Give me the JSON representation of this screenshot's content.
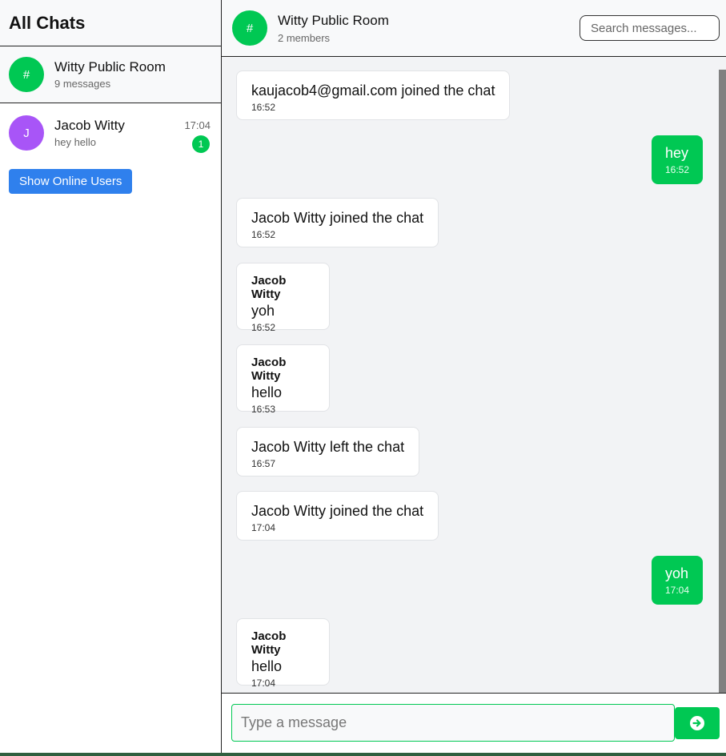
{
  "sidebar": {
    "title": "All Chats",
    "chats": [
      {
        "name": "Witty Public Room",
        "sub": "9 messages",
        "avatar": "#",
        "avatar_color": "#00c853"
      },
      {
        "name": "Jacob Witty",
        "sub": "hey hello",
        "avatar": "J",
        "avatar_color": "#a855f7",
        "time": "17:04",
        "unread": "1"
      }
    ],
    "online_button": "Show Online Users"
  },
  "header": {
    "avatar": "#",
    "title": "Witty Public Room",
    "members": "2 members",
    "search_placeholder": "Search messages..."
  },
  "messages": [
    {
      "dir": "in",
      "text": "kaujacob4@gmail.com joined the chat",
      "time": "16:52"
    },
    {
      "dir": "out",
      "text": "hey",
      "time": "16:52"
    },
    {
      "dir": "in",
      "text": "Jacob Witty joined the chat",
      "time": "16:52"
    },
    {
      "dir": "in",
      "sender": "Jacob Witty",
      "text": "yoh",
      "time": "16:52"
    },
    {
      "dir": "in",
      "sender": "Jacob Witty",
      "text": "hello",
      "time": "16:53"
    },
    {
      "dir": "in",
      "text": "Jacob Witty left the chat",
      "time": "16:57"
    },
    {
      "dir": "in",
      "text": "Jacob Witty joined the chat",
      "time": "17:04"
    },
    {
      "dir": "out",
      "text": "yoh",
      "time": "17:04"
    },
    {
      "dir": "in",
      "sender": "Jacob Witty",
      "text": "hello",
      "time": "17:04"
    }
  ],
  "composer": {
    "placeholder": "Type a message"
  },
  "colors": {
    "accent": "#00c853",
    "button_blue": "#2f80ed",
    "dm_avatar": "#a855f7"
  }
}
